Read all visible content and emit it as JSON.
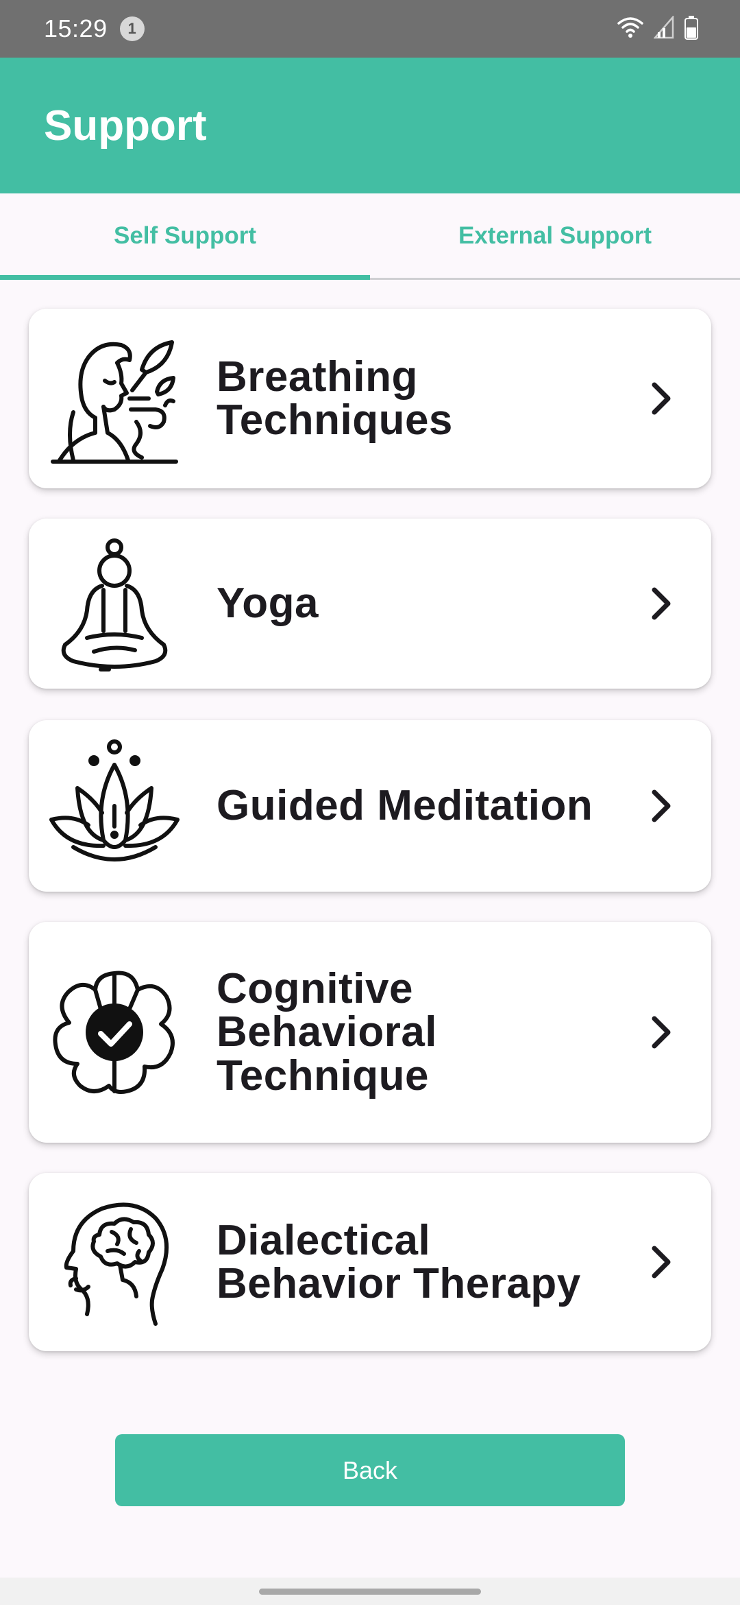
{
  "status_bar": {
    "time": "15:29",
    "notification_count": "1",
    "icons": [
      "wifi-icon",
      "signal-icon",
      "battery-icon"
    ]
  },
  "app_bar": {
    "title": "Support"
  },
  "tabs": [
    {
      "label": "Self Support",
      "active": true
    },
    {
      "label": "External Support",
      "active": false
    }
  ],
  "cards": [
    {
      "label": "Breathing Techniques",
      "icon": "breathing-icon"
    },
    {
      "label": "Yoga",
      "icon": "yoga-icon"
    },
    {
      "label": "Guided Meditation",
      "icon": "lotus-icon"
    },
    {
      "label": "Cognitive Behavioral Technique",
      "icon": "flower-check-icon"
    },
    {
      "label": "Dialectical Behavior Therapy",
      "icon": "brain-head-icon"
    }
  ],
  "back_button": {
    "label": "Back"
  },
  "colors": {
    "accent": "#43bea3",
    "status_bar": "#707070",
    "background": "#fcf8fc",
    "card_text": "#1d1b20"
  }
}
